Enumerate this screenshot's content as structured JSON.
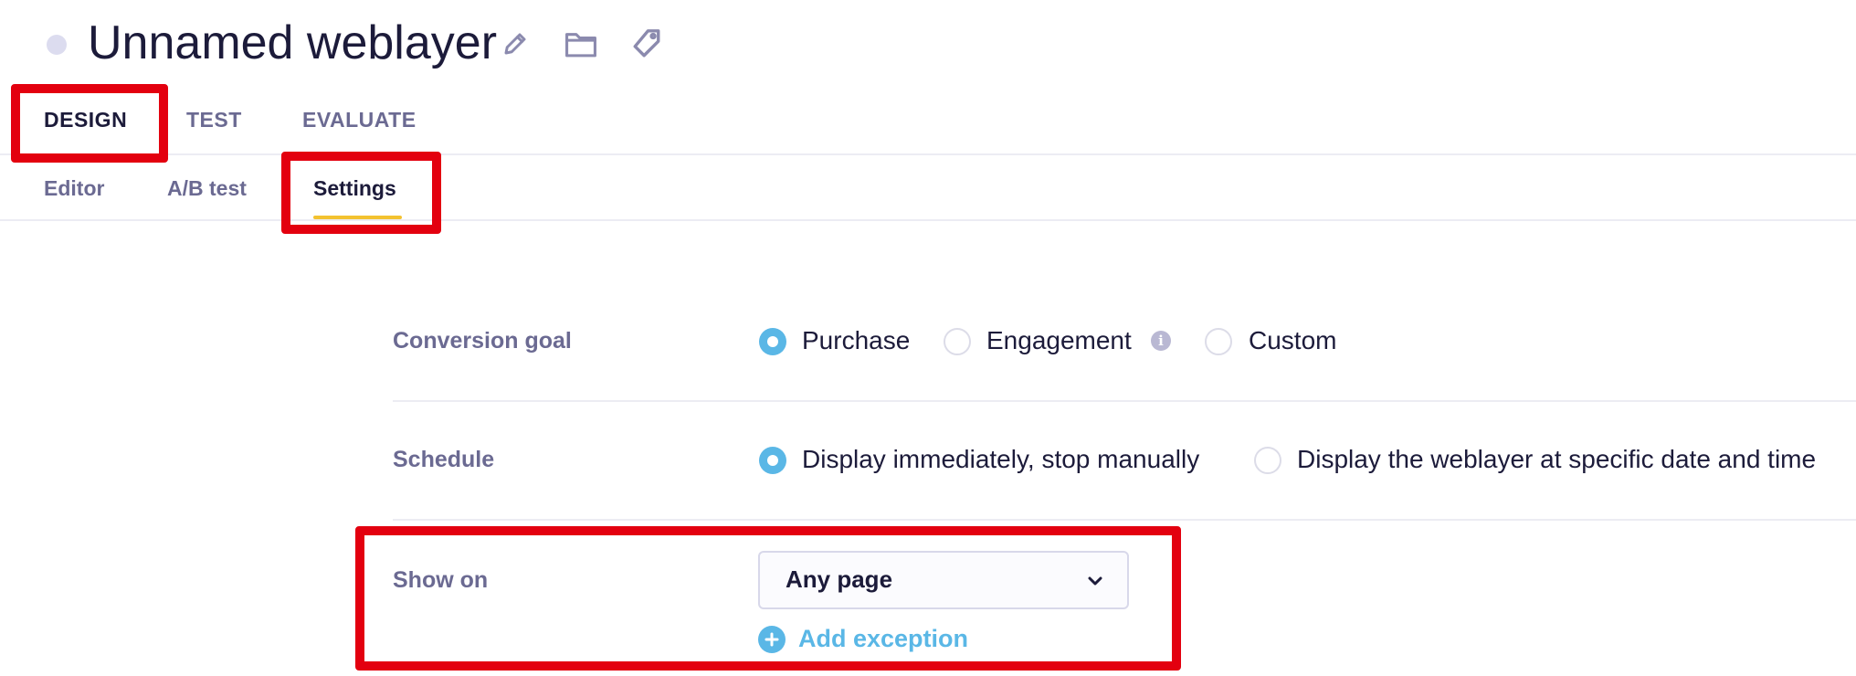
{
  "header": {
    "title": "Unnamed weblayer",
    "icons": [
      "pencil-icon",
      "folder-icon",
      "tag-icon"
    ]
  },
  "tabs": [
    {
      "label": "DESIGN",
      "active": true
    },
    {
      "label": "TEST",
      "active": false
    },
    {
      "label": "EVALUATE",
      "active": false
    }
  ],
  "subtabs": [
    {
      "label": "Editor",
      "active": false
    },
    {
      "label": "A/B test",
      "active": false
    },
    {
      "label": "Settings",
      "active": true
    }
  ],
  "settings": {
    "conversion_goal": {
      "label": "Conversion goal",
      "options": [
        {
          "label": "Purchase",
          "checked": true
        },
        {
          "label": "Engagement",
          "checked": false,
          "info": true
        },
        {
          "label": "Custom",
          "checked": false
        }
      ]
    },
    "schedule": {
      "label": "Schedule",
      "options": [
        {
          "label": "Display immediately, stop manually",
          "checked": true
        },
        {
          "label": "Display the weblayer at specific date and time",
          "checked": false
        }
      ]
    },
    "show_on": {
      "label": "Show on",
      "selected": "Any page",
      "add_exception_label": "Add exception"
    }
  },
  "colors": {
    "accent": "#5ab7e6",
    "tab_underline": "#f3c230",
    "annotation": "#e3000f"
  }
}
